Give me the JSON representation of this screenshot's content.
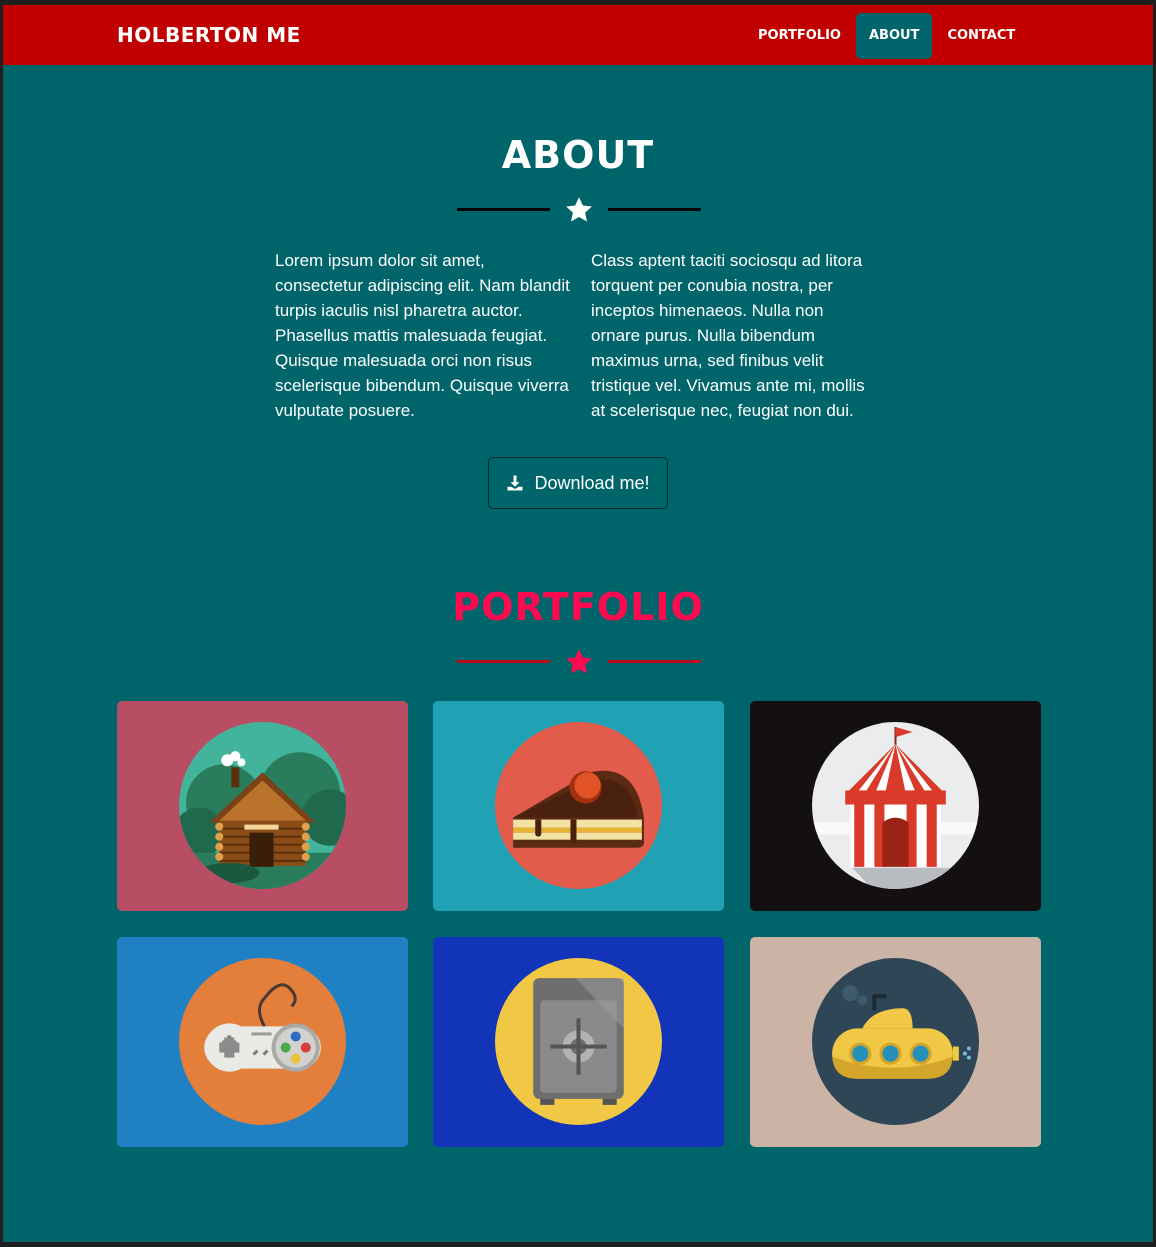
{
  "navbar": {
    "brand": "HOLBERTON ME",
    "links": [
      {
        "label": "PORTFOLIO"
      },
      {
        "label": "ABOUT",
        "active": true
      },
      {
        "label": "CONTACT"
      }
    ]
  },
  "about": {
    "title": "ABOUT",
    "paragraph_1": "Lorem ipsum dolor sit amet, consectetur adipiscing elit. Nam blandit turpis iaculis nisl pharetra auctor. Phasellus mattis malesuada feugiat. Quisque malesuada orci non risus scelerisque bibendum. Quisque viverra vulputate posuere.",
    "paragraph_2": "Class aptent taciti sociosqu ad litora torquent per conubia nostra, per inceptos himenaeos. Nulla non ornare purus. Nulla bibendum maximus urna, sed finibus velit tristique vel. Vivamus ante mi, mollis at scelerisque nec, feugiat non dui.",
    "download_label": "Download me!"
  },
  "portfolio": {
    "title": "PORTFOLIO",
    "items": [
      {
        "icon": "cabin-icon"
      },
      {
        "icon": "cake-icon"
      },
      {
        "icon": "circus-tent-icon"
      },
      {
        "icon": "game-controller-icon"
      },
      {
        "icon": "safe-icon"
      },
      {
        "icon": "submarine-icon"
      }
    ]
  },
  "colors": {
    "nav_bg": "#c00000",
    "page_bg": "#00656a",
    "portfolio_accent": "#ff0a50"
  }
}
